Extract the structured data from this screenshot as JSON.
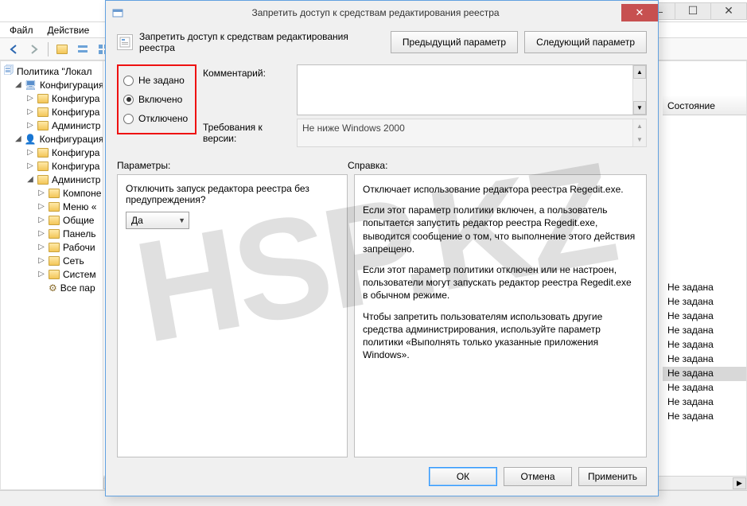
{
  "watermark": "HSP.KZ",
  "parent": {
    "menu": {
      "file": "Файл",
      "action": "Действие"
    },
    "toolbar_icons": [
      "arrow-left",
      "arrow-right",
      "folder-up",
      "list-view",
      "grid-view"
    ],
    "tree": {
      "root": "Политика \"Локал",
      "cfg_computer": "Конфигурация",
      "cfg_user": "Конфигурация",
      "sw_conf": "Конфигура",
      "win_conf": "Конфигура",
      "admin1": "Администр",
      "admin2": "Администр",
      "components": "Компоне",
      "menu_panel": "Меню «",
      "shared": "Общие",
      "control_panel": "Панель",
      "desktop": "Рабочи",
      "network": "Сеть",
      "system": "Систем",
      "all_params": "Все пар"
    },
    "list": {
      "state_header": "Состояние",
      "states": [
        "Не задана",
        "Не задана",
        "Не задана",
        "Не задана",
        "Не задана",
        "Не задана",
        "Не задана",
        "Не задана",
        "Не задана",
        "Не задана"
      ],
      "selected_index": 6
    }
  },
  "dialog": {
    "title": "Запретить доступ к средствам редактирования реестра",
    "header_title": "Запретить доступ к средствам редактирования реестра",
    "prev_btn": "Предыдущий параметр",
    "next_btn": "Следующий параметр",
    "radio": {
      "not_configured": "Не задано",
      "enabled": "Включено",
      "disabled": "Отключено",
      "selected": "enabled"
    },
    "comment_label": "Комментарий:",
    "requirements_label": "Требования к версии:",
    "requirements_value": "Не ниже Windows 2000",
    "params_label": "Параметры:",
    "help_label": "Справка:",
    "option_question": "Отключить запуск редактора реестра без предупреждения?",
    "option_value": "Да",
    "help_p1": "Отключает использование редактора реестра Regedit.exe.",
    "help_p2": "Если этот параметр политики включен, а пользователь попытается запустить редактор реестра Regedit.exe, выводится сообщение о том, что выполнение этого действия запрещено.",
    "help_p3": "Если этот параметр политики отключен или не настроен, пользователи могут запускать редактор реестра Regedit.exe в обычном режиме.",
    "help_p4": "Чтобы запретить пользователям использовать другие средства администрирования, используйте параметр политики «Выполнять только указанные приложения Windows».",
    "buttons": {
      "ok": "ОК",
      "cancel": "Отмена",
      "apply": "Применить"
    }
  }
}
